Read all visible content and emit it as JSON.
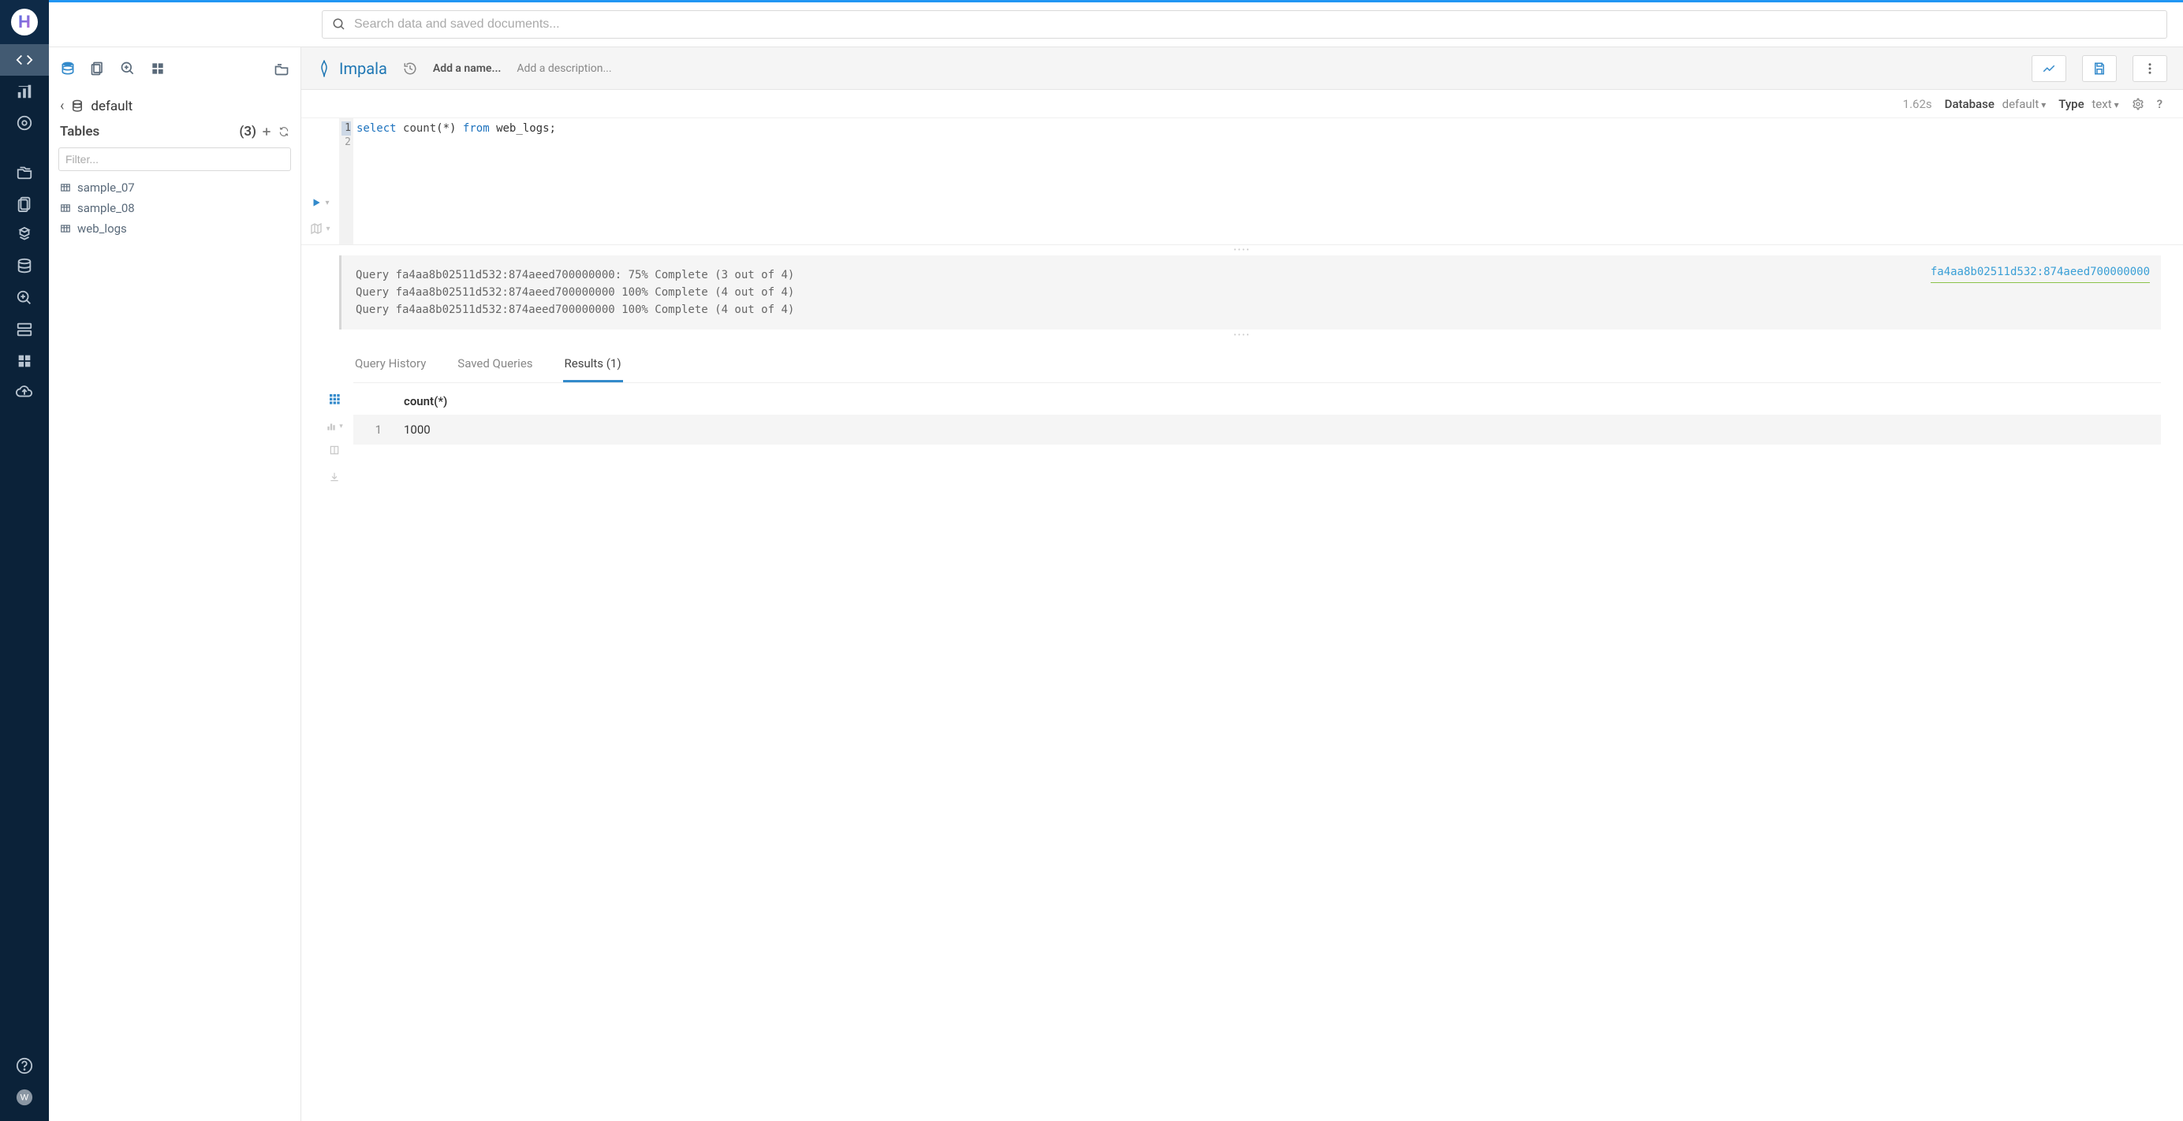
{
  "search": {
    "placeholder": "Search data and saved documents..."
  },
  "engine": {
    "name": "Impala"
  },
  "editor_header": {
    "add_name": "Add a name...",
    "add_description": "Add a description..."
  },
  "subbar": {
    "elapsed": "1.62s",
    "database_label": "Database",
    "database_value": "default",
    "type_label": "Type",
    "type_value": "text"
  },
  "breadcrumb": {
    "database": "default"
  },
  "tables": {
    "heading": "Tables",
    "count": "(3)",
    "filter_placeholder": "Filter...",
    "items": [
      {
        "name": "sample_07"
      },
      {
        "name": "sample_08"
      },
      {
        "name": "web_logs"
      }
    ]
  },
  "code": {
    "line1_kw1": "select",
    "line1_fn": "count",
    "line1_paren_star": "(*)",
    "line1_kw2": "from",
    "line1_tbl": "web_logs",
    "line1_end": ";"
  },
  "log": {
    "lines": [
      "Query fa4aa8b02511d532:874aeed700000000: 75% Complete (3 out of 4)",
      "Query fa4aa8b02511d532:874aeed700000000 100% Complete (4 out of 4)",
      "Query fa4aa8b02511d532:874aeed700000000 100% Complete (4 out of 4)"
    ],
    "query_id": "fa4aa8b02511d532:874aeed700000000"
  },
  "tabs": {
    "history": "Query History",
    "saved": "Saved Queries",
    "results": "Results (1)"
  },
  "results": {
    "columns": [
      "count(*)"
    ],
    "rows": [
      {
        "n": "1",
        "cells": [
          "1000"
        ]
      }
    ]
  }
}
